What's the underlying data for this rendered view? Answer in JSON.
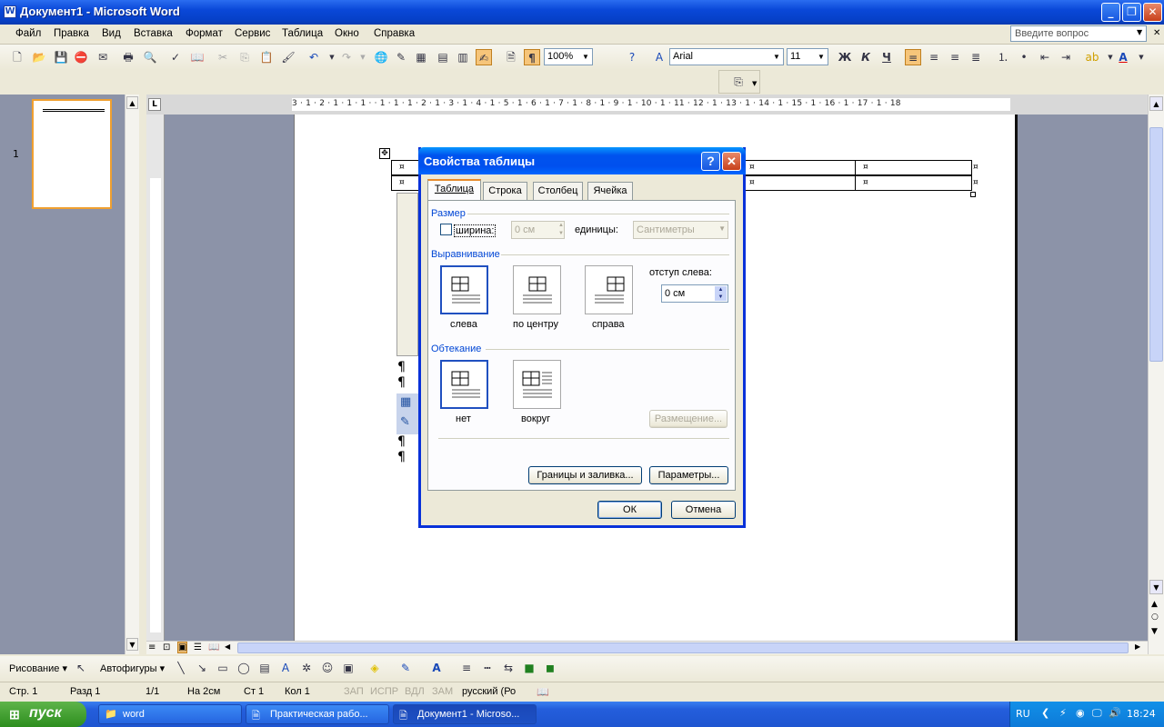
{
  "window": {
    "title": "Документ1 - Microsoft Word"
  },
  "menu": {
    "items": [
      "Файл",
      "Правка",
      "Вид",
      "Вставка",
      "Формат",
      "Сервис",
      "Таблица",
      "Окно",
      "Справка"
    ],
    "ask_placeholder": "Введите вопрос"
  },
  "toolbar": {
    "zoom": "100%",
    "font": "Arial",
    "size": "11"
  },
  "thumbs": {
    "page_number": "1"
  },
  "ruler": {
    "numbers": "3 · 1 · 2 · 1 · 1 · 1 ·   · 1 · 1 · 1 · 2 · 1 · 3 · 1 · 4 · 1 · 5 · 1 · 6 · 1 · 7 · 1 · 8 · 1 · 9 · 1 · 10 · 1 · 11 · 12 · 1 · 13 · 1 · 14 · 1 · 15 · 1 · 16 · 1 · 17 · 1 · 18"
  },
  "doc": {
    "cell_mark": "¤",
    "para_mark": "¶"
  },
  "dialog": {
    "title": "Свойства таблицы",
    "tabs": [
      "Таблица",
      "Строка",
      "Столбец",
      "Ячейка"
    ],
    "size_group": "Размер",
    "width_label": "ширина:",
    "width_value": "0 см",
    "units_label": "единицы:",
    "units_value": "Сантиметры",
    "align_group": "Выравнивание",
    "align_options": [
      "слева",
      "по центру",
      "справа"
    ],
    "indent_label": "отступ слева:",
    "indent_value": "0 см",
    "wrap_group": "Обтекание",
    "wrap_options": [
      "нет",
      "вокруг"
    ],
    "placement_button": "Размещение...",
    "borders_button": "Границы и заливка...",
    "options_button": "Параметры...",
    "ok_button": "ОК",
    "cancel_button": "Отмена"
  },
  "drawbar": {
    "drawing": "Рисование",
    "autoshapes": "Автофигуры"
  },
  "status": {
    "page": "Стр. 1",
    "section": "Разд 1",
    "pages": "1/1",
    "at": "На 2см",
    "line": "Ст 1",
    "col": "Кол 1",
    "rec": "ЗАП",
    "trk": "ИСПР",
    "ext": "ВДЛ",
    "ovr": "ЗАМ",
    "lang": "русский (Ро"
  },
  "taskbar": {
    "start": "пуск",
    "tasks": [
      "word",
      "Практическая рабо...",
      "Документ1 - Microso..."
    ],
    "lang": "RU",
    "clock": "18:24"
  }
}
